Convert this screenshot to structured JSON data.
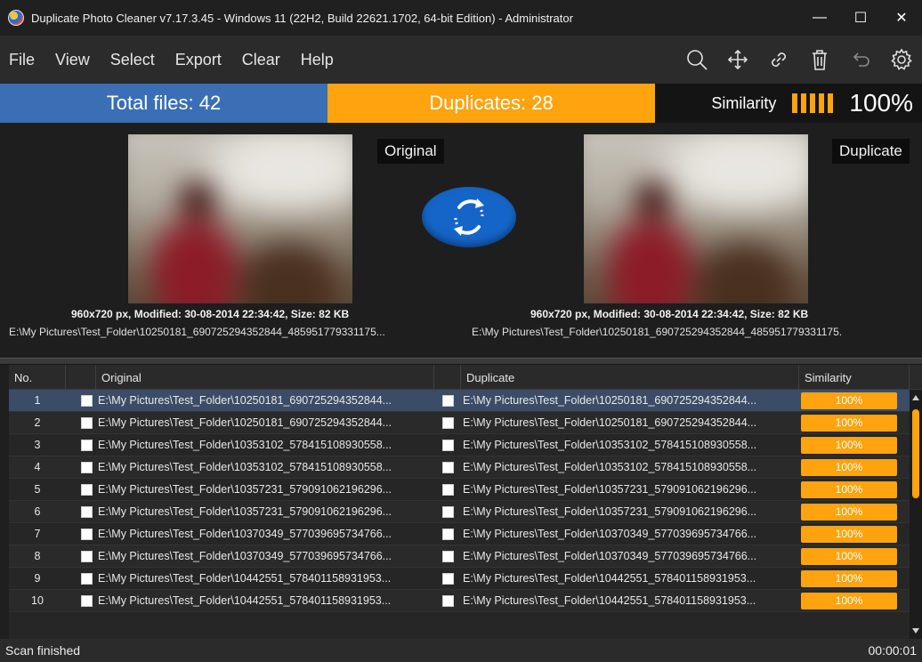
{
  "window": {
    "title": "Duplicate Photo Cleaner v7.17.3.45 - Windows 11 (22H2, Build 22621.1702, 64-bit Edition) - Administrator",
    "minimize": "—",
    "maximize": "☐",
    "close": "✕"
  },
  "menu": [
    "File",
    "View",
    "Select",
    "Export",
    "Clear",
    "Help"
  ],
  "toolbar": {
    "icons": [
      "search-icon",
      "move-icon",
      "link-icon",
      "trash-icon",
      "undo-icon",
      "gear-icon"
    ]
  },
  "stats": {
    "total": "Total files: 42",
    "duplicates": "Duplicates: 28",
    "similarity_label": "Similarity",
    "similarity_value": "100%",
    "similarity_level": 1.0
  },
  "preview": {
    "original_tag": "Original",
    "duplicate_tag": "Duplicate",
    "original_meta": "960x720 px, Modified: 30-08-2014 22:34:42, Size: 82 KB",
    "duplicate_meta": "960x720 px, Modified: 30-08-2014 22:34:42, Size: 82 KB",
    "original_path": "E:\\My Pictures\\Test_Folder\\10250181_690725294352844_485951779331175...",
    "duplicate_path": "E:\\My Pictures\\Test_Folder\\10250181_690725294352844_485951779331175."
  },
  "table": {
    "headers": {
      "no": "No.",
      "original": "Original",
      "duplicate": "Duplicate",
      "similarity": "Similarity"
    },
    "rows": [
      {
        "no": "1",
        "original": "E:\\My Pictures\\Test_Folder\\10250181_690725294352844...",
        "duplicate": "E:\\My Pictures\\Test_Folder\\10250181_690725294352844...",
        "similarity": "100%"
      },
      {
        "no": "2",
        "original": "E:\\My Pictures\\Test_Folder\\10250181_690725294352844...",
        "duplicate": "E:\\My Pictures\\Test_Folder\\10250181_690725294352844...",
        "similarity": "100%"
      },
      {
        "no": "3",
        "original": "E:\\My Pictures\\Test_Folder\\10353102_578415108930558...",
        "duplicate": "E:\\My Pictures\\Test_Folder\\10353102_578415108930558...",
        "similarity": "100%"
      },
      {
        "no": "4",
        "original": "E:\\My Pictures\\Test_Folder\\10353102_578415108930558...",
        "duplicate": "E:\\My Pictures\\Test_Folder\\10353102_578415108930558...",
        "similarity": "100%"
      },
      {
        "no": "5",
        "original": "E:\\My Pictures\\Test_Folder\\10357231_579091062196296...",
        "duplicate": "E:\\My Pictures\\Test_Folder\\10357231_579091062196296...",
        "similarity": "100%"
      },
      {
        "no": "6",
        "original": "E:\\My Pictures\\Test_Folder\\10357231_579091062196296...",
        "duplicate": "E:\\My Pictures\\Test_Folder\\10357231_579091062196296...",
        "similarity": "100%"
      },
      {
        "no": "7",
        "original": "E:\\My Pictures\\Test_Folder\\10370349_577039695734766...",
        "duplicate": "E:\\My Pictures\\Test_Folder\\10370349_577039695734766...",
        "similarity": "100%"
      },
      {
        "no": "8",
        "original": "E:\\My Pictures\\Test_Folder\\10370349_577039695734766...",
        "duplicate": "E:\\My Pictures\\Test_Folder\\10370349_577039695734766...",
        "similarity": "100%"
      },
      {
        "no": "9",
        "original": "E:\\My Pictures\\Test_Folder\\10442551_578401158931953...",
        "duplicate": "E:\\My Pictures\\Test_Folder\\10442551_578401158931953...",
        "similarity": "100%"
      },
      {
        "no": "10",
        "original": "E:\\My Pictures\\Test_Folder\\10442551_578401158931953...",
        "duplicate": "E:\\My Pictures\\Test_Folder\\10442551_578401158931953...",
        "similarity": "100%"
      }
    ]
  },
  "status": {
    "message": "Scan finished",
    "elapsed": "00:00:01"
  },
  "colors": {
    "accent": "#ffa30f",
    "total_bg": "#3a6fb5",
    "selected_row": "#3b4d66"
  }
}
